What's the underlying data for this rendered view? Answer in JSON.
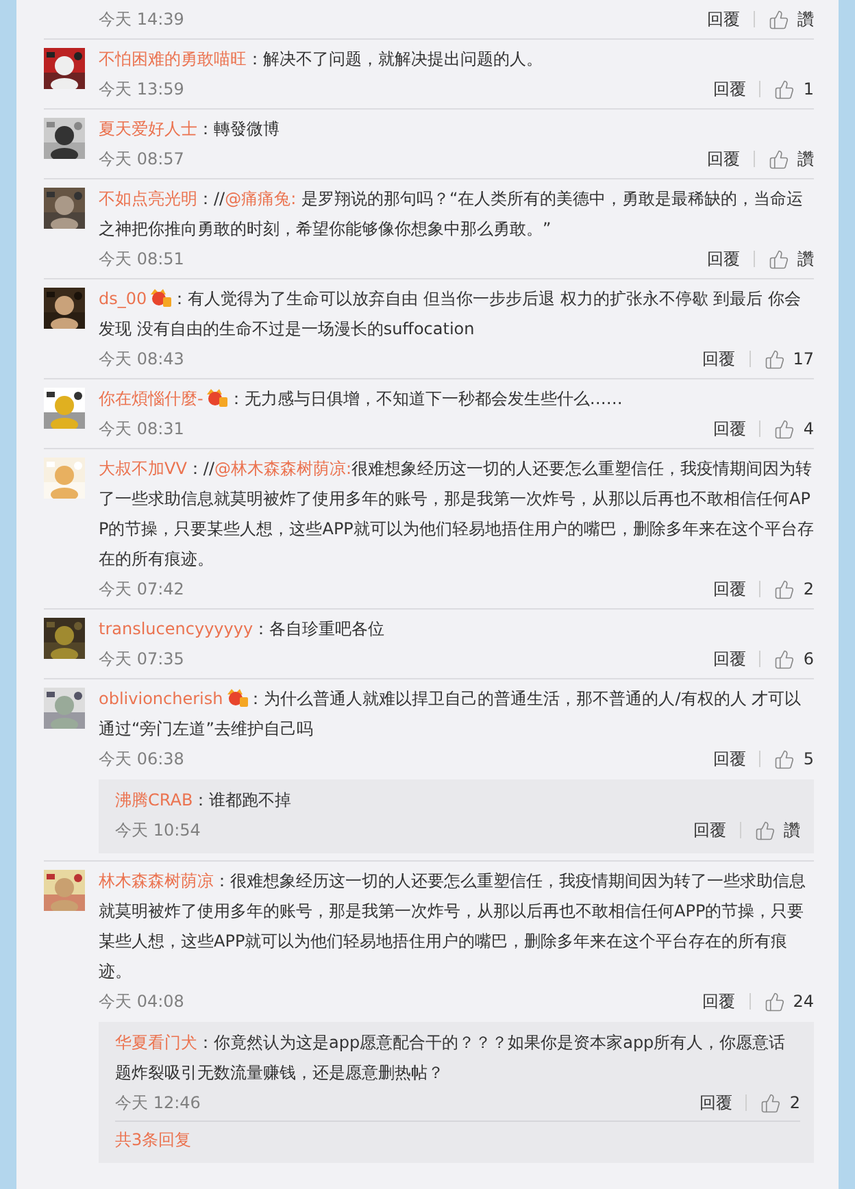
{
  "top_row": {
    "time": "今天 14:39",
    "reply": "回覆",
    "like": "讚"
  },
  "comments": [
    {
      "user": "不怕困难的勇敢喵旺",
      "vip": false,
      "sep": "：",
      "text": "解决不了问题，就解决提出问题的人。",
      "time": "今天 13:59",
      "reply": "回覆",
      "like": "1"
    },
    {
      "user": "夏天爱好人士",
      "vip": false,
      "sep": "：",
      "text": "轉發微博",
      "time": "今天 08:57",
      "reply": "回覆",
      "like": "讚"
    },
    {
      "user": "不如点亮光明",
      "vip": false,
      "sep": "：//",
      "mention": "@痛痛兔:",
      "text": " 是罗翔说的那句吗？“在人类所有的美德中，勇敢是最稀缺的，当命运之神把你推向勇敢的时刻，希望你能够像你想象中那么勇敢。”",
      "time": "今天 08:51",
      "reply": "回覆",
      "like": "讚"
    },
    {
      "user": "ds_00",
      "vip": true,
      "sep": "：",
      "text": "有人觉得为了生命可以放弃自由 但当你一步步后退 权力的扩张永不停歇 到最后 你会发现 没有自由的生命不过是一场漫长的suffocation",
      "time": "今天 08:43",
      "reply": "回覆",
      "like": "17"
    },
    {
      "user": "你在煩惱什麼-",
      "vip": true,
      "sep": "：",
      "text": "无力感与日俱增，不知道下一秒都会发生些什么……",
      "time": "今天 08:31",
      "reply": "回覆",
      "like": "4"
    },
    {
      "user": "大叔不加VV",
      "vip": false,
      "sep": "：//",
      "mention": "@林木森森树荫凉:",
      "text": "很难想象经历这一切的人还要怎么重塑信任，我疫情期间因为转了一些求助信息就莫明被炸了使用多年的账号，那是我第一次炸号，从那以后再也不敢相信任何APP的节操，只要某些人想，这些APP就可以为他们轻易地捂住用户的嘴巴，删除多年来在这个平台存在的所有痕迹。",
      "time": "今天 07:42",
      "reply": "回覆",
      "like": "2"
    },
    {
      "user": "translucencyyyyyy",
      "vip": false,
      "sep": "：",
      "text": "各自珍重吧各位",
      "time": "今天 07:35",
      "reply": "回覆",
      "like": "6"
    },
    {
      "user": "oblivioncherish",
      "vip": true,
      "sep": "：",
      "text": "为什么普通人就难以捍卫自己的普通生活，那不普通的人/有权的人 才可以通过“旁门左道”去维护自己吗",
      "time": "今天 06:38",
      "reply": "回覆",
      "like": "5",
      "replies": [
        {
          "user": "沸腾CRAB",
          "sep": "：",
          "text": "谁都跑不掉",
          "time": "今天 10:54",
          "reply": "回覆",
          "like": "讚"
        }
      ]
    },
    {
      "user": "林木森森树荫凉",
      "vip": false,
      "sep": "：",
      "text": "很难想象经历这一切的人还要怎么重塑信任，我疫情期间因为转了一些求助信息就莫明被炸了使用多年的账号，那是我第一次炸号，从那以后再也不敢相信任何APP的节操，只要某些人想，这些APP就可以为他们轻易地捂住用户的嘴巴，删除多年来在这个平台存在的所有痕迹。",
      "time": "今天 04:08",
      "reply": "回覆",
      "like": "24",
      "replies": [
        {
          "user": "华夏看门犬",
          "sep": "：",
          "text": "你竟然认为这是app愿意配合干的？？？如果你是资本家app所有人，你愿意话题炸裂吸引无数流量赚钱，还是愿意删热帖？",
          "time": "今天 12:46",
          "reply": "回覆",
          "like": "2"
        }
      ],
      "more": "共3条回复"
    }
  ]
}
